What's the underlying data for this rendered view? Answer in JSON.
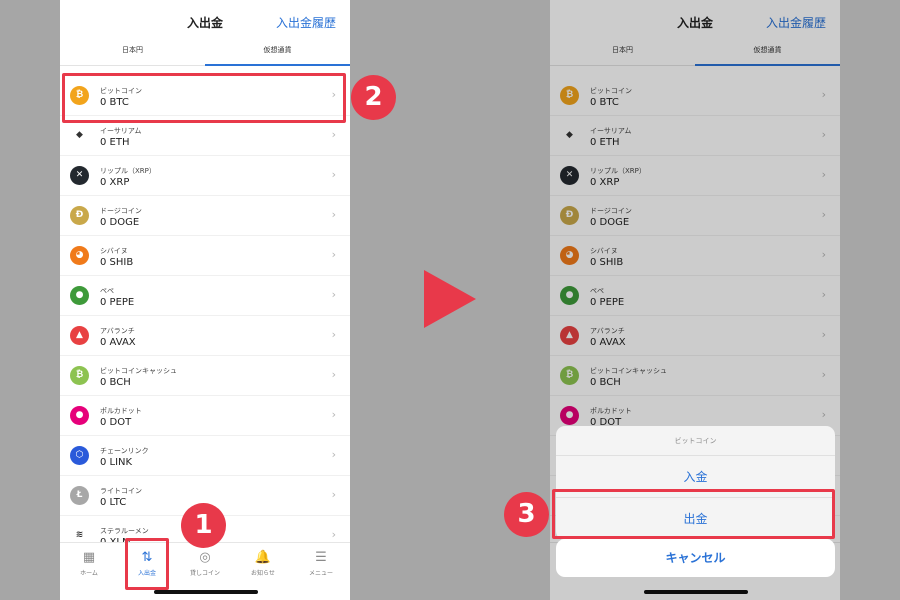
{
  "header": {
    "title": "入出金",
    "history_link": "入出金履歴"
  },
  "tabs": [
    {
      "label": "日本円"
    },
    {
      "label": "仮想通貨"
    }
  ],
  "coins": [
    {
      "name": "ビットコイン",
      "balance": "0 BTC",
      "icon": "bitcoin-icon",
      "glyph": "₿",
      "color": "#f2a41c"
    },
    {
      "name": "イーサリアム",
      "balance": "0 ETH",
      "icon": "ethereum-icon",
      "glyph": "◆",
      "color": "#ffffff"
    },
    {
      "name": "リップル（XRP）",
      "balance": "0 XRP",
      "icon": "xrp-icon",
      "glyph": "✕",
      "color": "#23292f"
    },
    {
      "name": "ドージコイン",
      "balance": "0 DOGE",
      "icon": "doge-icon",
      "glyph": "Ð",
      "color": "#c9a84a"
    },
    {
      "name": "シバイヌ",
      "balance": "0 SHIB",
      "icon": "shib-icon",
      "glyph": "◕",
      "color": "#f07a1a"
    },
    {
      "name": "ペペ",
      "balance": "0 PEPE",
      "icon": "pepe-icon",
      "glyph": "●",
      "color": "#3e9a3a"
    },
    {
      "name": "アバランチ",
      "balance": "0 AVAX",
      "icon": "avax-icon",
      "glyph": "▲",
      "color": "#e84142"
    },
    {
      "name": "ビットコインキャッシュ",
      "balance": "0 BCH",
      "icon": "bch-icon",
      "glyph": "₿",
      "color": "#8dc351"
    },
    {
      "name": "ポルカドット",
      "balance": "0 DOT",
      "icon": "dot-icon",
      "glyph": "●",
      "color": "#e6007a"
    },
    {
      "name": "チェーンリンク",
      "balance": "0 LINK",
      "icon": "link-icon",
      "glyph": "⬡",
      "color": "#2a5ada"
    },
    {
      "name": "ライトコイン",
      "balance": "0 LTC",
      "icon": "ltc-icon",
      "glyph": "Ł",
      "color": "#a7a7a7"
    },
    {
      "name": "ステラルーメン",
      "balance": "0 XLM",
      "icon": "xlm-icon",
      "glyph": "≋",
      "color": "#ffffff"
    }
  ],
  "nav": [
    {
      "label": "ホーム",
      "icon": "home-icon",
      "glyph": "▦"
    },
    {
      "label": "入出金",
      "icon": "transfer-icon",
      "glyph": "⇅"
    },
    {
      "label": "貸しコイン",
      "icon": "lending-icon",
      "glyph": "◎"
    },
    {
      "label": "お知らせ",
      "icon": "bell-icon",
      "glyph": "🔔"
    },
    {
      "label": "メニュー",
      "icon": "menu-icon",
      "glyph": "☰"
    }
  ],
  "action_sheet": {
    "title": "ビットコイン",
    "deposit": "入金",
    "withdraw": "出金",
    "cancel": "キャンセル"
  },
  "annotations": {
    "step1": "1",
    "step2": "2",
    "step3": "3"
  },
  "colors": {
    "accent": "#2a72d6",
    "highlight": "#e8394a"
  }
}
